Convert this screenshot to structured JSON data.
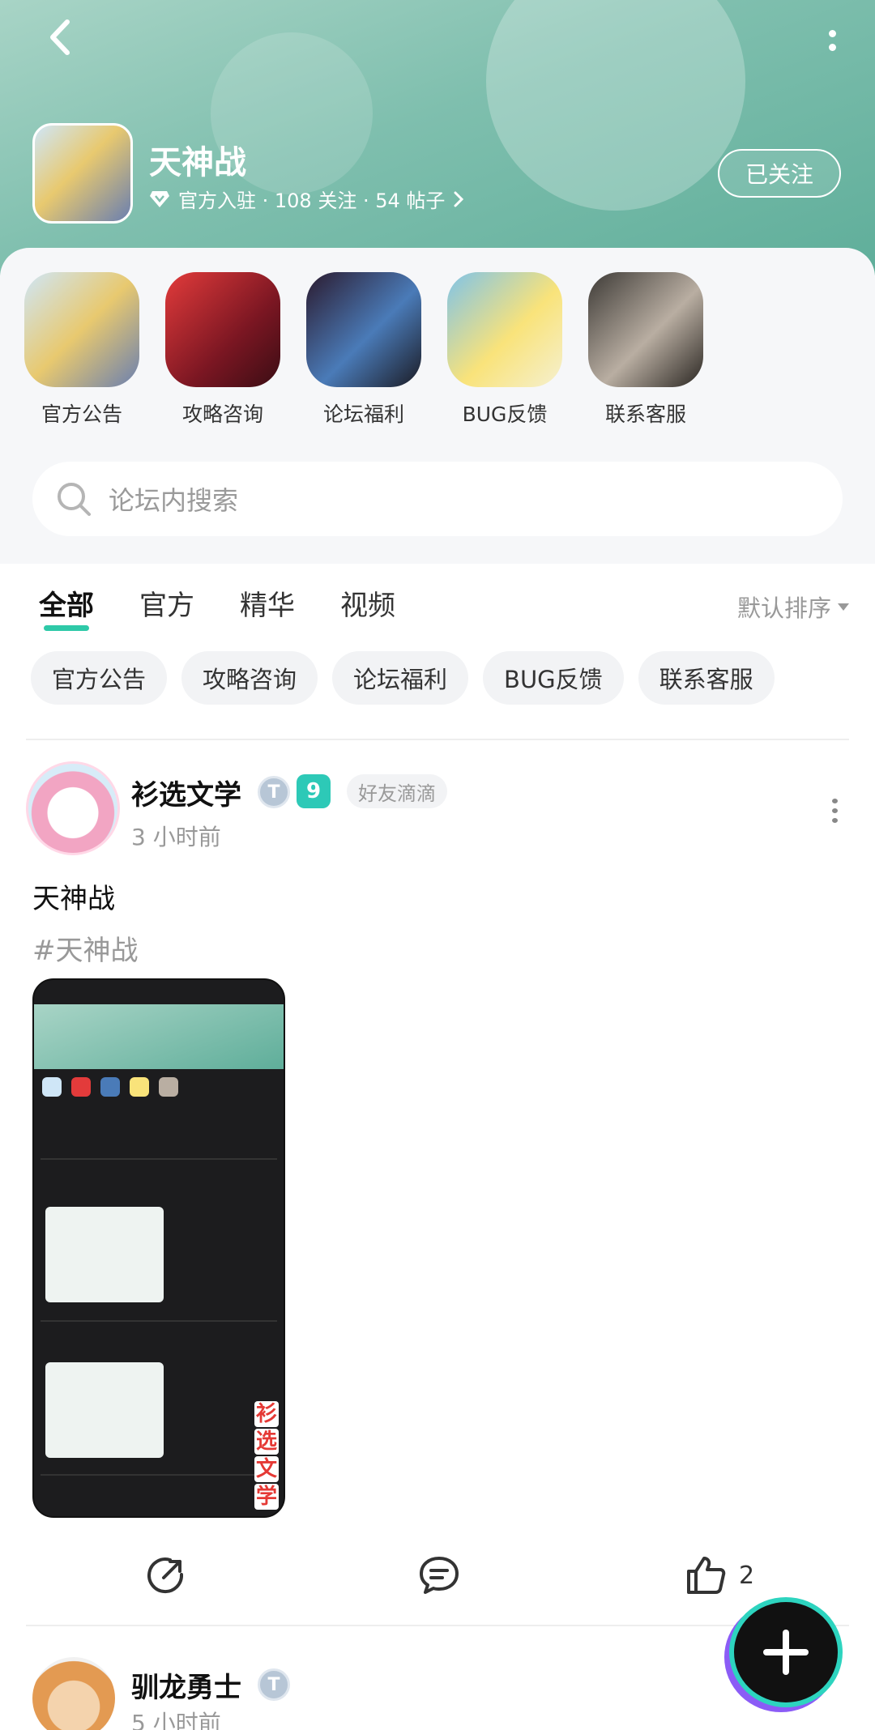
{
  "header": {
    "forum_name": "天神战",
    "meta": "官方入驻 · 108 关注 · 54 帖子",
    "follow_button": "已关注"
  },
  "quick_links": [
    {
      "label": "官方公告",
      "color_a": "#cfe6f7",
      "color_b": "#c99a3d"
    },
    {
      "label": "攻略咨询",
      "color_a": "#e33b3b",
      "color_b": "#3a0d14"
    },
    {
      "label": "论坛福利",
      "color_a": "#2b1a2e",
      "color_b": "#4a7bb8"
    },
    {
      "label": "BUG反馈",
      "color_a": "#f9e37a",
      "color_b": "#7fc3e8"
    },
    {
      "label": "联系客服",
      "color_a": "#3d3a36",
      "color_b": "#b9aea2"
    }
  ],
  "search": {
    "placeholder": "论坛内搜索"
  },
  "tabs": [
    "全部",
    "官方",
    "精华",
    "视频"
  ],
  "sort_label": "默认排序",
  "chips": [
    "官方公告",
    "攻略咨询",
    "论坛福利",
    "BUG反馈",
    "联系客服"
  ],
  "posts": [
    {
      "author": "衫选文学",
      "level_badge": "T",
      "rank_badge": "9",
      "tag": "好友滴滴",
      "time": "3 小时前",
      "title": "天神战",
      "hashtag": "#天神战",
      "watermark": [
        "衫",
        "选",
        "文",
        "学"
      ],
      "likes": "2"
    },
    {
      "author": "驯龙勇士",
      "level_badge": "T",
      "time": "5 小时前"
    }
  ],
  "colors": {
    "accent": "#2ec9a8",
    "banner": "#7fbfae",
    "muted": "#999999"
  }
}
